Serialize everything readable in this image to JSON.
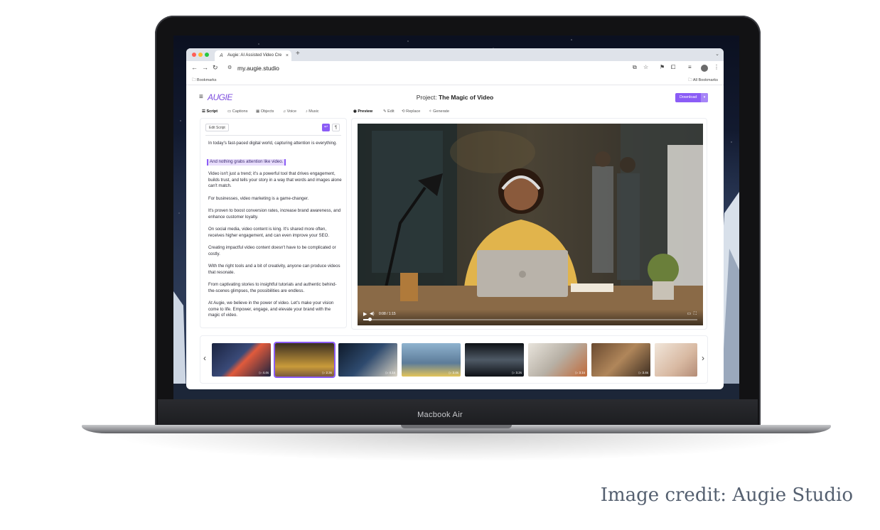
{
  "browser": {
    "tab_title": "Augie: AI Assisted Video Cre",
    "tab_close": "×",
    "new_tab": "+",
    "url": "my.augie.studio",
    "bookmarks_label": "Bookmarks",
    "all_bookmarks_label": "All Bookmarks"
  },
  "app": {
    "logo": "AUGIE",
    "project_prefix": "Project:",
    "project_name": "The Magic of Video",
    "download_label": "Download",
    "left_tabs": [
      "Script",
      "Captions",
      "Objects",
      "Voice",
      "Music"
    ],
    "right_tabs": [
      "Preview",
      "Edit",
      "Replace",
      "Generate"
    ],
    "edit_script_label": "Edit Script",
    "script_paragraphs": [
      "In today's fast-paced digital world, capturing attention is everything.",
      "And nothing grabs attention like video.",
      "Video isn't just a trend; it's a powerful tool that drives engagement, builds trust, and tells your story in a way that words and images alone can't match.",
      "For businesses, video marketing is a game-changer.",
      "It's proven to boost conversion rates, increase brand awareness, and enhance customer loyalty.",
      "On social media, video content is king. It's shared more often, receives higher engagement, and can even improve your SEO.",
      "Creating impactful video content doesn't have to be complicated or costly.",
      "With the right tools and a bit of creativity, anyone can produce videos that resonate.",
      "From captivating stories to insightful tutorials and authentic behind-the-scenes glimpses, the possibilities are endless.",
      "At Augie, we believe in the power of video. Let's make your vision come to life. Empower, engage, and elevate your brand with the magic of video."
    ],
    "highlighted_paragraph_index": 1,
    "video": {
      "time": "0:08 / 1:15",
      "progress": 0.02
    },
    "thumbnails": [
      {
        "duration": "4.4s"
      },
      {
        "duration": "2.3s"
      },
      {
        "duration": "4.1s"
      },
      {
        "duration": "3.4s"
      },
      {
        "duration": "3.2s"
      },
      {
        "duration": "3.1s"
      },
      {
        "duration": "3.4s"
      },
      {
        "duration": ""
      }
    ],
    "selected_thumbnail_index": 1
  },
  "device": {
    "label": "Macbook Air"
  },
  "credit": "Image credit: Augie Studio",
  "colors": {
    "accent": "#8b5cf6",
    "highlight_bg": "#e9defd"
  }
}
